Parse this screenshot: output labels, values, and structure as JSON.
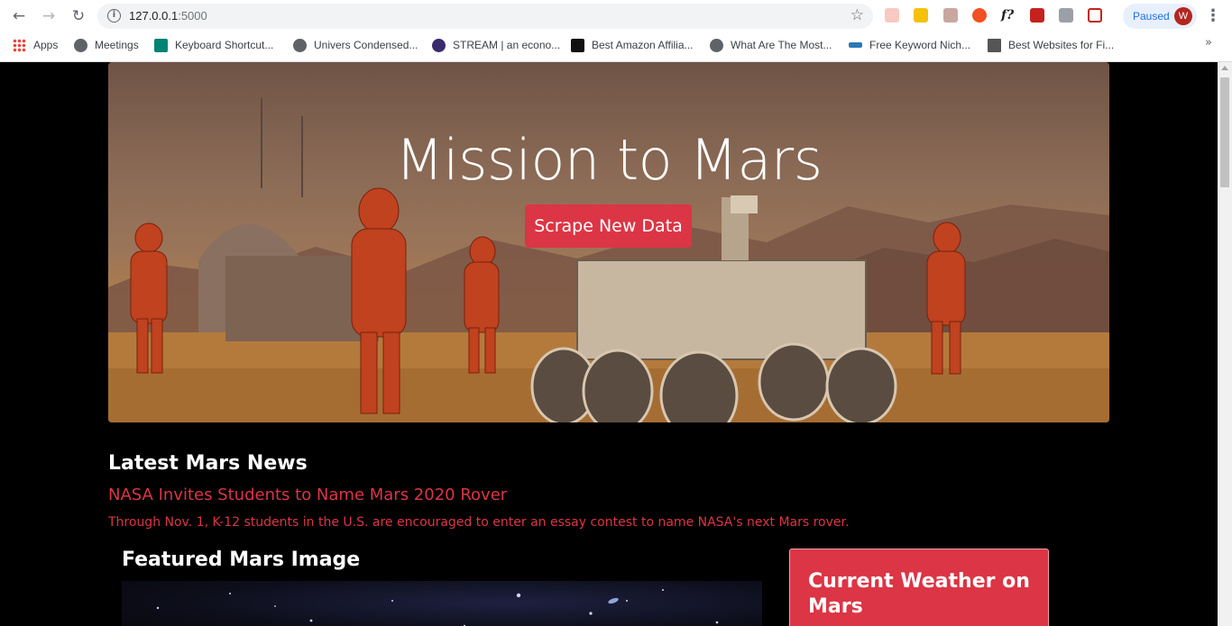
{
  "browser": {
    "url_host": "127.0.0.1",
    "url_port": ":5000",
    "profile_status": "Paused",
    "profile_initial": "W",
    "bookmarks": [
      {
        "label": "Apps",
        "icon": "apps-grid-icon"
      },
      {
        "label": "Meetings",
        "icon": "globe-icon"
      },
      {
        "label": "Keyboard Shortcut...",
        "icon": "bing-icon"
      },
      {
        "label": "Univers Condensed...",
        "icon": "globe-icon"
      },
      {
        "label": "STREAM | an econo...",
        "icon": "stream-icon"
      },
      {
        "label": "Best Amazon Affilia...",
        "icon": "ta-icon"
      },
      {
        "label": "What Are The Most...",
        "icon": "globe-icon"
      },
      {
        "label": "Free Keyword Nich...",
        "icon": "wave-icon"
      },
      {
        "label": "Best Websites for Fi...",
        "icon": "site-icon"
      }
    ]
  },
  "hero": {
    "title": "Mission to Mars",
    "button_label": "Scrape New Data"
  },
  "news": {
    "heading": "Latest Mars News",
    "title": "NASA Invites Students to Name Mars 2020 Rover",
    "teaser": "Through Nov. 1, K-12 students in the U.S. are encouraged to enter an essay contest to name NASA's next Mars rover."
  },
  "featured_image": {
    "heading": "Featured Mars Image"
  },
  "weather": {
    "heading": "Current Weather on Mars"
  },
  "colors": {
    "accent": "#dc3545",
    "page_bg": "#000000"
  }
}
